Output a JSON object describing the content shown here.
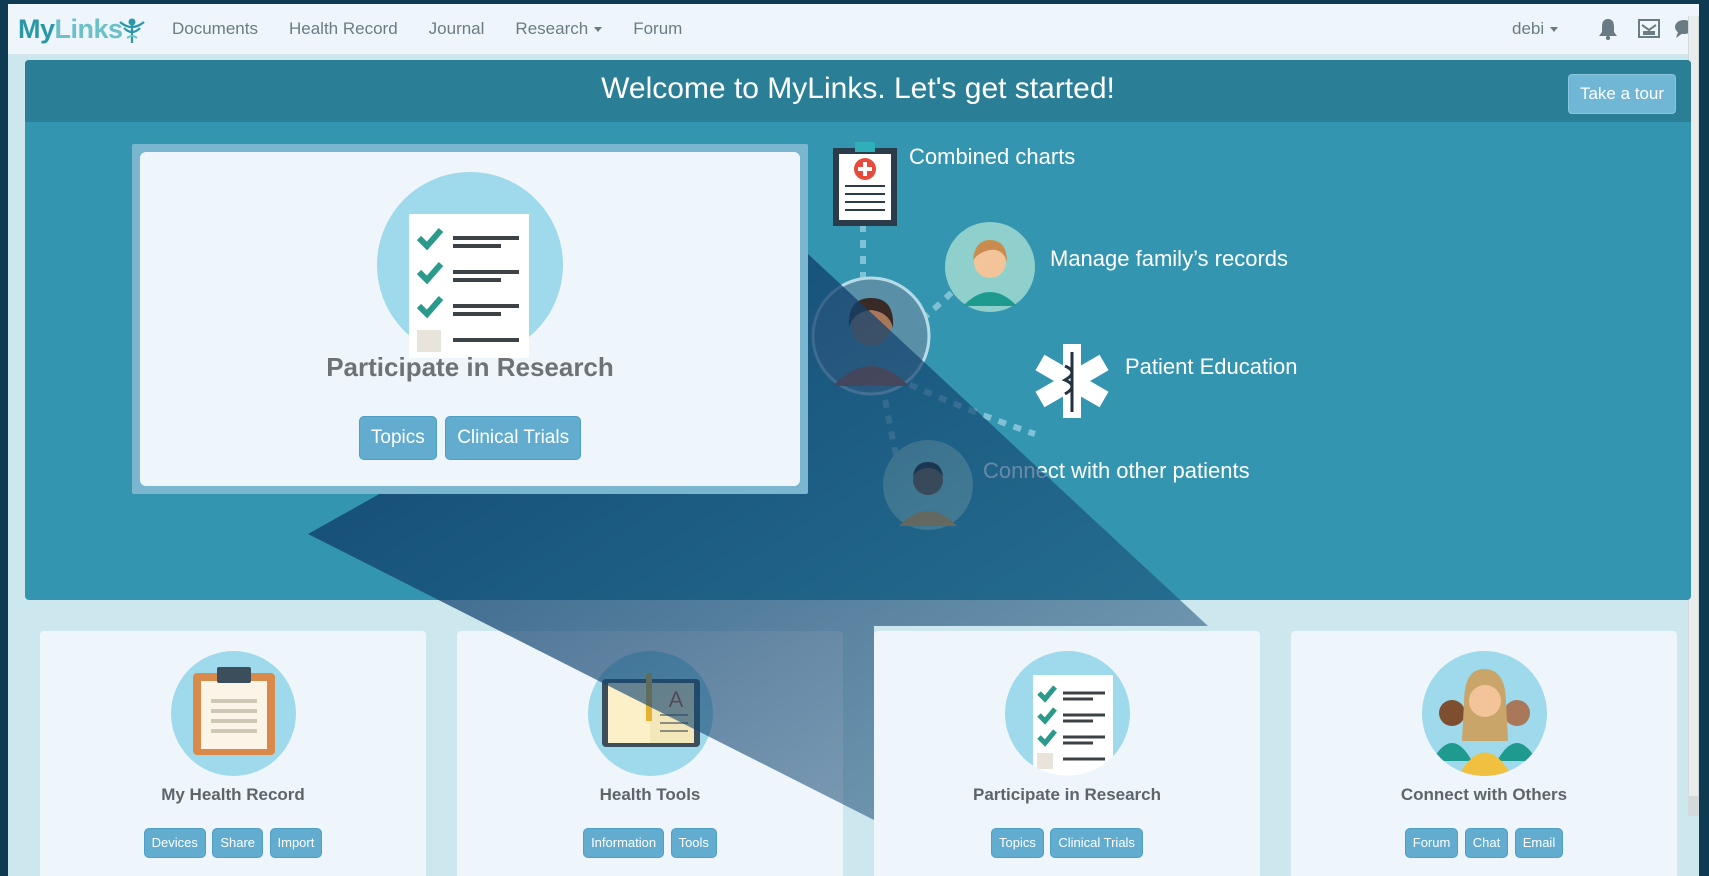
{
  "nav": {
    "logo_my": "My",
    "logo_links": "Links",
    "links": [
      "Documents",
      "Health Record",
      "Journal",
      "Research",
      "Forum"
    ],
    "user": "debi",
    "icons": [
      "bell-icon",
      "inbox-icon",
      "chat-icon"
    ]
  },
  "hero": {
    "title": "Welcome to MyLinks. Let's get started!",
    "tour_button": "Take a tour",
    "features": [
      "Combined charts",
      "Manage family’s records",
      "Patient Education",
      "Connect with other patients"
    ]
  },
  "popup": {
    "title": "Participate in Research",
    "buttons": [
      "Topics",
      "Clinical Trials"
    ]
  },
  "cards": [
    {
      "title": "My Health Record",
      "buttons": [
        "Devices",
        "Share",
        "Import"
      ],
      "icon": "clipboard-icon"
    },
    {
      "title": "Health Tools",
      "buttons": [
        "Information",
        "Tools"
      ],
      "icon": "book-icon"
    },
    {
      "title": "Participate in Research",
      "buttons": [
        "Topics",
        "Clinical Trials"
      ],
      "icon": "checklist-icon"
    },
    {
      "title": "Connect with Others",
      "buttons": [
        "Forum",
        "Chat",
        "Email"
      ],
      "icon": "people-icon"
    }
  ],
  "colors": {
    "brand": "#2b98a8",
    "hero": "#3495b0",
    "button": "#62acd0"
  }
}
